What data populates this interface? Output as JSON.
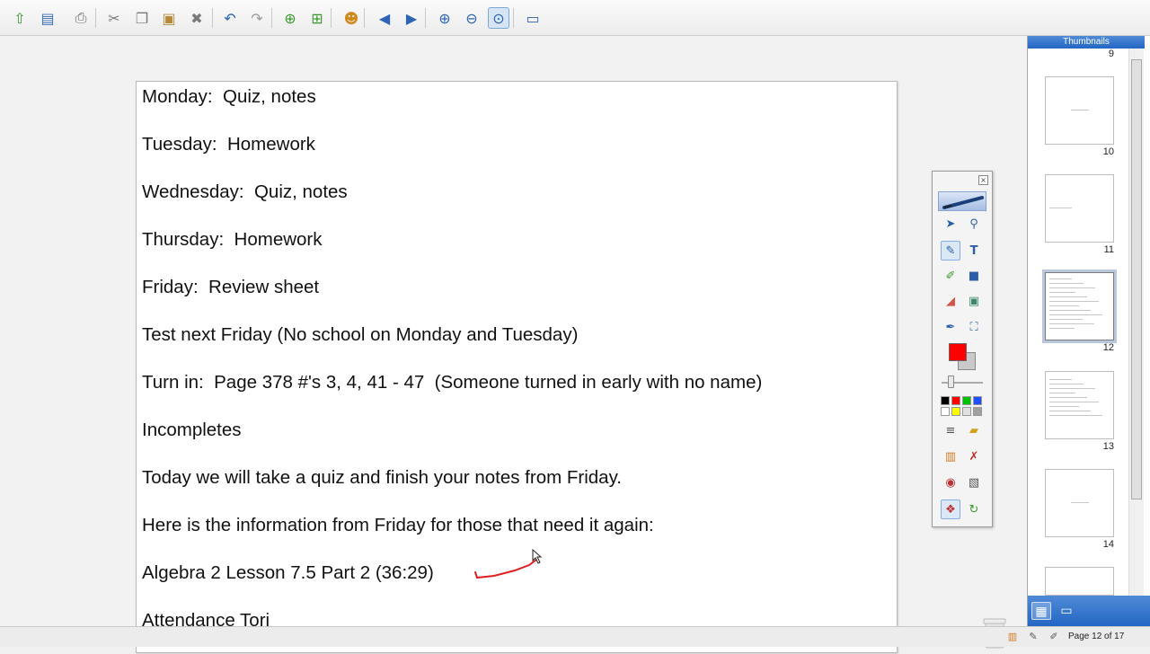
{
  "toolbar": {
    "buttons": [
      {
        "name": "open-icon",
        "glyph": "⇧",
        "color": "#3b9a2e"
      },
      {
        "name": "save-icon",
        "glyph": "▤",
        "color": "#3a6fb5"
      },
      {
        "name": "print-icon",
        "glyph": "⎙",
        "color": "#6a6a6a"
      },
      {
        "name": "cut-icon",
        "glyph": "✂",
        "color": "#7a7a7a"
      },
      {
        "name": "copy-icon",
        "glyph": "❐",
        "color": "#7a7a7a"
      },
      {
        "name": "paste-icon",
        "glyph": "▣",
        "color": "#b58a3a"
      },
      {
        "name": "delete-icon",
        "glyph": "✖",
        "color": "#7a7a7a"
      },
      {
        "name": "undo-icon",
        "glyph": "↶",
        "color": "#2e63b5"
      },
      {
        "name": "redo-icon",
        "glyph": "↷",
        "color": "#9a9a9a"
      },
      {
        "name": "add-page-icon",
        "glyph": "⊕",
        "color": "#3b9a2e"
      },
      {
        "name": "duplicate-page-icon",
        "glyph": "⊞",
        "color": "#3b9a2e"
      },
      {
        "name": "users-icon",
        "glyph": "☻",
        "color": "#d08a1e"
      },
      {
        "name": "previous-page-icon",
        "glyph": "◀",
        "color": "#2e63b5"
      },
      {
        "name": "next-page-icon",
        "glyph": "▶",
        "color": "#2e63b5"
      },
      {
        "name": "zoom-in-icon",
        "glyph": "⊕",
        "color": "#2e63b5"
      },
      {
        "name": "zoom-out-icon",
        "glyph": "⊖",
        "color": "#2e63b5"
      },
      {
        "name": "zoom-fit-icon",
        "glyph": "⊙",
        "color": "#2e63b5"
      },
      {
        "name": "screen-icon",
        "glyph": "▭",
        "color": "#2e63b5"
      }
    ]
  },
  "page": {
    "lines": [
      "Monday:  Quiz, notes",
      "Tuesday:  Homework",
      "Wednesday:  Quiz, notes",
      "Thursday:  Homework",
      "Friday:  Review sheet",
      "Test next Friday (No school on Monday and Tuesday)",
      "Turn in:  Page 378 #'s 3, 4, 41 - 47  (Someone turned in early with no name)",
      "Incompletes",
      "Today we will take a quiz and finish your notes from Friday.",
      "Here is the information from Friday for those that need it again:",
      "Algebra 2 Lesson 7.5 Part 2 (36:29)",
      "Attendance Tori"
    ],
    "ink_color": "#e02020"
  },
  "palette": {
    "close_glyph": "×",
    "primary_color": "#ff0000",
    "secondary_color": "#c9c9c9",
    "swatches_row1": [
      "#000000",
      "#ff0000",
      "#00c000",
      "#1f4fff"
    ],
    "swatches_row2": [
      "#ffffff",
      "#ffff00",
      "#e0e0e0",
      "#a0a0a0"
    ]
  },
  "sidebar": {
    "title": "Thumbnails",
    "thumbnails": [
      {
        "number": "9"
      },
      {
        "number": "10"
      },
      {
        "number": "11"
      },
      {
        "number": "12",
        "selected": true
      },
      {
        "number": "13"
      },
      {
        "number": "14"
      }
    ]
  },
  "status": {
    "page_indicator": "Page 12 of 17"
  }
}
